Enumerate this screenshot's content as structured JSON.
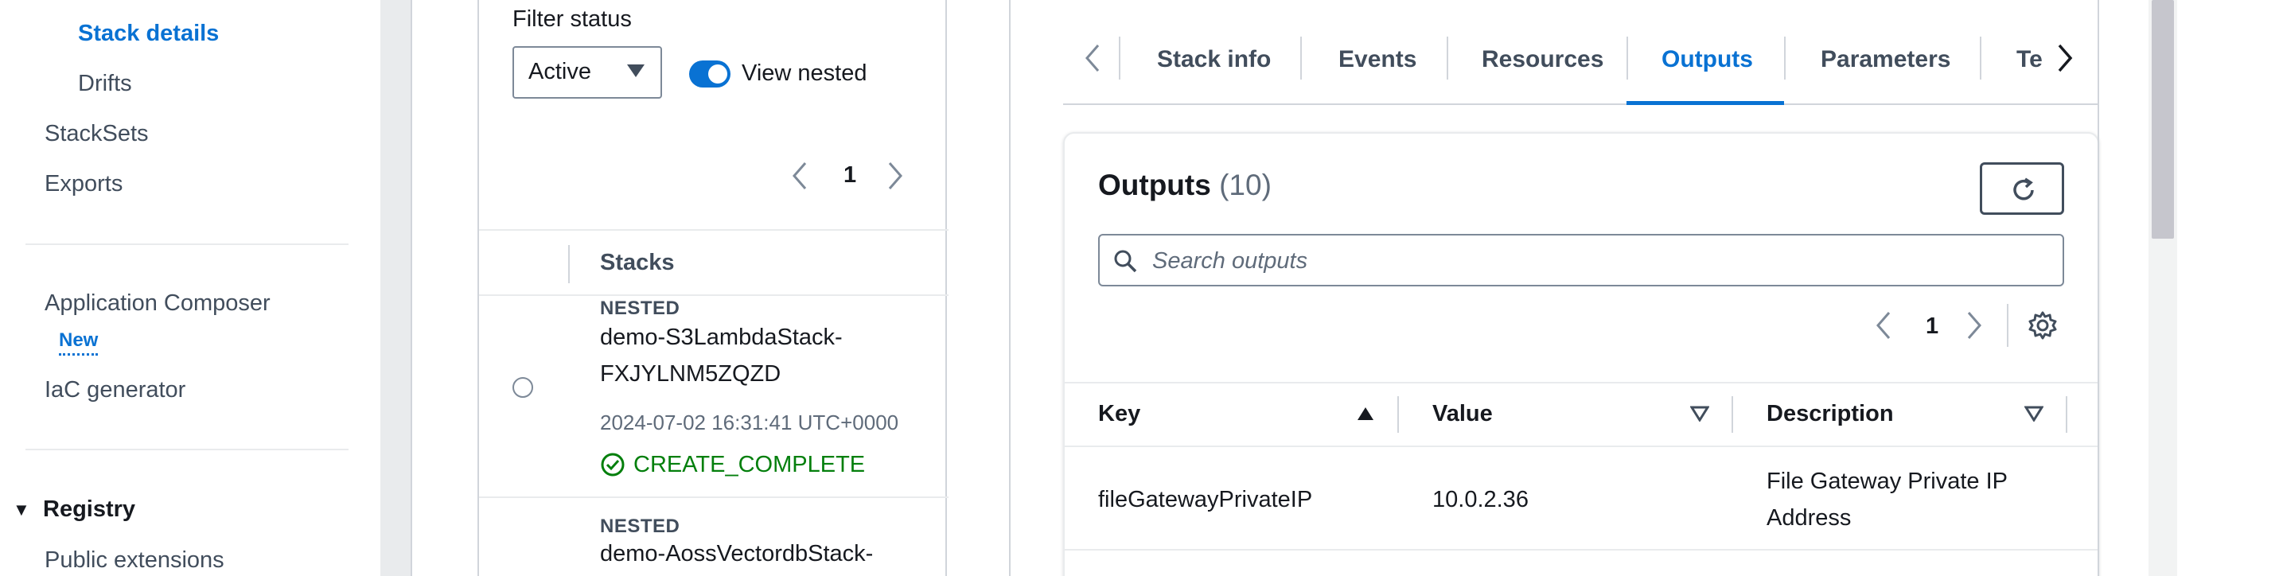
{
  "sidenav": {
    "items": [
      {
        "label": "Stack details",
        "active": true
      },
      {
        "label": "Drifts"
      },
      {
        "label": "StackSets"
      },
      {
        "label": "Exports"
      },
      {
        "label": "Application Composer",
        "badge": "New"
      },
      {
        "label": "IaC generator"
      },
      {
        "label": "Registry",
        "section": true
      },
      {
        "label": "Public extensions"
      }
    ]
  },
  "stacks": {
    "filter_label": "Filter status",
    "filter_value": "Active",
    "view_nested_label": "View nested",
    "view_nested_on": true,
    "page": "1",
    "column_header": "Stacks",
    "rows": [
      {
        "tag": "NESTED",
        "name_line1": "demo-S3LambdaStack-",
        "name_line2": "FXJYLNM5ZQZD",
        "time": "2024-07-02 16:31:41 UTC+0000",
        "status": "CREATE_COMPLETE"
      },
      {
        "tag": "NESTED",
        "name_line1": "demo-AossVectordbStack-"
      }
    ]
  },
  "tabs": {
    "items": [
      {
        "label": "Stack info"
      },
      {
        "label": "Events"
      },
      {
        "label": "Resources"
      },
      {
        "label": "Outputs",
        "active": true
      },
      {
        "label": "Parameters"
      },
      {
        "label": "Te"
      }
    ]
  },
  "outputs": {
    "title": "Outputs",
    "count": "(10)",
    "search_placeholder": "Search outputs",
    "page": "1",
    "columns": [
      "Key",
      "Value",
      "Description"
    ],
    "rows": [
      {
        "key": "fileGatewayPrivateIP",
        "value": "10.0.2.36",
        "description": "File Gateway Private IP Address"
      }
    ]
  },
  "colors": {
    "accent": "#0972d3",
    "success": "#037f0c",
    "text": "#16191f",
    "muted": "#5f6b7a"
  }
}
